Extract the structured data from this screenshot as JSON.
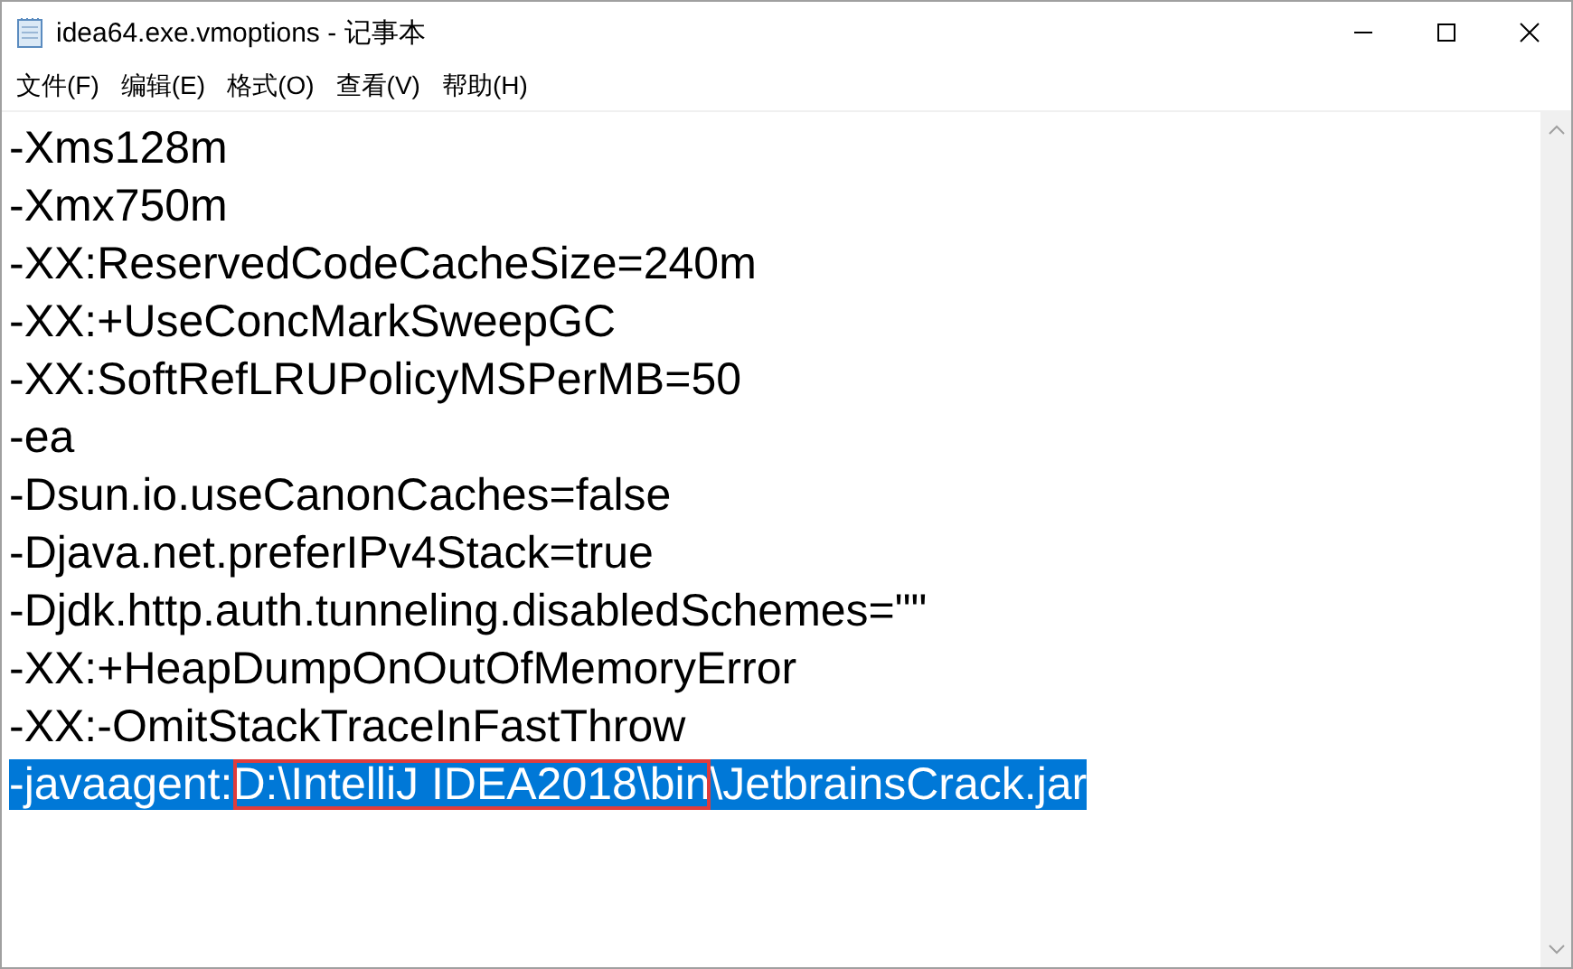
{
  "window": {
    "title": "idea64.exe.vmoptions - 记事本"
  },
  "menu": [
    {
      "label": "文件(F)"
    },
    {
      "label": "编辑(E)"
    },
    {
      "label": "格式(O)"
    },
    {
      "label": "查看(V)"
    },
    {
      "label": "帮助(H)"
    }
  ],
  "lines": [
    {
      "selected": false,
      "segments": [
        {
          "text": "-Xms128m",
          "boxed": false
        }
      ]
    },
    {
      "selected": false,
      "segments": [
        {
          "text": "-Xmx750m",
          "boxed": false
        }
      ]
    },
    {
      "selected": false,
      "segments": [
        {
          "text": "-XX:ReservedCodeCacheSize=240m",
          "boxed": false
        }
      ]
    },
    {
      "selected": false,
      "segments": [
        {
          "text": "-XX:+UseConcMarkSweepGC",
          "boxed": false
        }
      ]
    },
    {
      "selected": false,
      "segments": [
        {
          "text": "-XX:SoftRefLRUPolicyMSPerMB=50",
          "boxed": false
        }
      ]
    },
    {
      "selected": false,
      "segments": [
        {
          "text": "-ea",
          "boxed": false
        }
      ]
    },
    {
      "selected": false,
      "segments": [
        {
          "text": "-Dsun.io.useCanonCaches=false",
          "boxed": false
        }
      ]
    },
    {
      "selected": false,
      "segments": [
        {
          "text": "-Djava.net.preferIPv4Stack=true",
          "boxed": false
        }
      ]
    },
    {
      "selected": false,
      "segments": [
        {
          "text": "-Djdk.http.auth.tunneling.disabledSchemes=\"\"",
          "boxed": false
        }
      ]
    },
    {
      "selected": false,
      "segments": [
        {
          "text": "-XX:+HeapDumpOnOutOfMemoryError",
          "boxed": false
        }
      ]
    },
    {
      "selected": false,
      "segments": [
        {
          "text": "-XX:-OmitStackTraceInFastThrow",
          "boxed": false
        }
      ]
    },
    {
      "selected": true,
      "segments": [
        {
          "text": "-javaagent:",
          "boxed": false
        },
        {
          "text": "D:\\IntelliJ IDEA2018\\bin",
          "boxed": true
        },
        {
          "text": "\\JetbrainsCrack.jar",
          "boxed": false
        }
      ]
    }
  ]
}
